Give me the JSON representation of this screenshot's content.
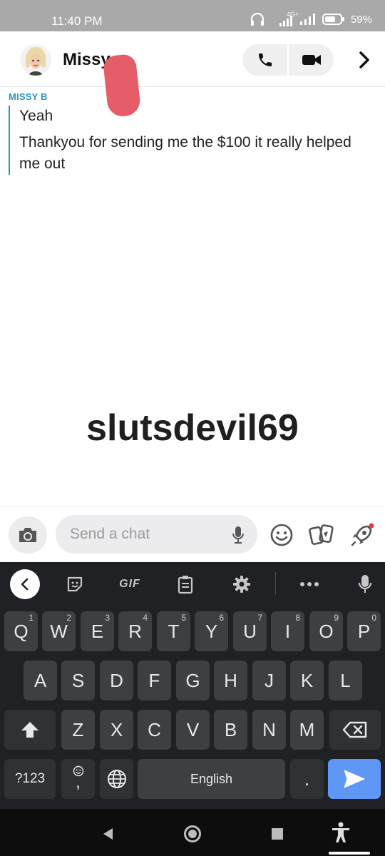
{
  "status_bar": {
    "time": "11:40 PM",
    "network": "4G+",
    "battery": "59%"
  },
  "header": {
    "contact_name": "Missy",
    "icons": [
      "bitmoji-avatar",
      "phone-icon",
      "video-camera-icon",
      "chevron-right-icon"
    ]
  },
  "conversation": {
    "sender": "MISSY B",
    "messages": [
      "Yeah",
      "Thankyou for sending me the $100 it really helped me out"
    ]
  },
  "overlay_text": "slutsdevil69",
  "input_bar": {
    "placeholder": "Send a chat",
    "icons": [
      "camera-icon",
      "microphone-icon",
      "smiley-icon",
      "cards-icon",
      "rocket-icon"
    ]
  },
  "keyboard": {
    "toolbar": {
      "gif_label": "GIF",
      "icons": [
        "back-chevron-icon",
        "sticker-icon",
        "clipboard-icon",
        "settings-icon",
        "more-icon",
        "microphone-icon"
      ]
    },
    "row1": [
      {
        "label": "Q",
        "hint": "1"
      },
      {
        "label": "W",
        "hint": "2"
      },
      {
        "label": "E",
        "hint": "3"
      },
      {
        "label": "R",
        "hint": "4"
      },
      {
        "label": "T",
        "hint": "5"
      },
      {
        "label": "Y",
        "hint": "6"
      },
      {
        "label": "U",
        "hint": "7"
      },
      {
        "label": "I",
        "hint": "8"
      },
      {
        "label": "O",
        "hint": "9"
      },
      {
        "label": "P",
        "hint": "0"
      }
    ],
    "row2": [
      "A",
      "S",
      "D",
      "F",
      "G",
      "H",
      "J",
      "K",
      "L"
    ],
    "row3": [
      "Z",
      "X",
      "C",
      "V",
      "B",
      "N",
      "M"
    ],
    "row4": {
      "symbols_label": "?123",
      "comma_label": ",",
      "space_label": "English",
      "period_label": "."
    },
    "accent_color": "#5e97f6"
  },
  "nav_bar": {
    "icons": [
      "back-triangle-icon",
      "home-circle-icon",
      "recents-square-icon",
      "accessibility-icon"
    ]
  }
}
